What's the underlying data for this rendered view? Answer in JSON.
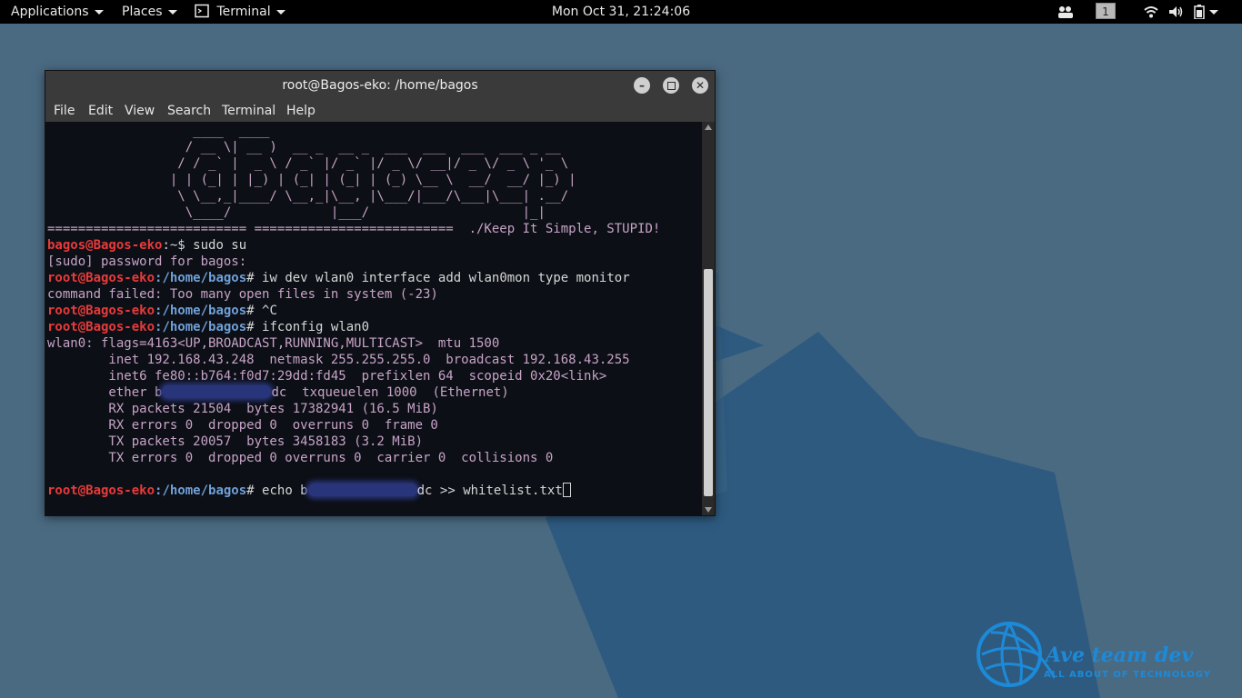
{
  "topbar": {
    "applications": "Applications",
    "places": "Places",
    "terminal": "Terminal",
    "clock": "Mon Oct 31, 21:24:06",
    "workspace": "1",
    "icons": [
      "people-icon",
      "wifi-icon",
      "volume-icon",
      "battery-icon",
      "power-menu-icon"
    ]
  },
  "window": {
    "title": "root@Bagos-eko: /home/bagos",
    "menu": [
      "File",
      "Edit",
      "View",
      "Search",
      "Terminal",
      "Help"
    ]
  },
  "terminal": {
    "ascii_art": [
      "                   ____  ____",
      "                  / __ \\| __ )  __ _  __ _  ___  ___  ___  ___ _ __",
      "                 / / _` |  _ \\ / _` |/ _` |/ _ \\/ __|/ _ \\/ _ \\ '_ \\",
      "                | | (_| | |_) | (_| | (_| | (_) \\__ \\  __/  __/ |_) |",
      "                 \\ \\__,_|____/ \\__,_|\\__, |\\___/|___/\\___|\\___| .__/",
      "                  \\____/             |___/                    |_|"
    ],
    "separator": "========================== ==========================  ./Keep It Simple, STUPID!",
    "user_prompt_user": "bagos@Bagos-eko",
    "user_prompt_rest": ":~$",
    "cmd_sudo": " sudo su",
    "sudo_prompt": "[sudo] password for bagos:",
    "root_prompt_host": "root@Bagos-eko",
    "root_prompt_path": ":/home/bagos",
    "root_prompt_end": "#",
    "cmd_iw": " iw dev wlan0 interface add wlan0mon type monitor",
    "err_iw": "command failed: Too many open files in system (-23)",
    "cmd_ctrlc": " ^C",
    "cmd_ifconfig": " ifconfig wlan0",
    "if_lines": [
      "wlan0: flags=4163<UP,BROADCAST,RUNNING,MULTICAST>  mtu 1500",
      "        inet 192.168.43.248  netmask 255.255.255.0  broadcast 192.168.43.255",
      "        inet6 fe80::b764:f0d7:29dd:fd45  prefixlen 64  scopeid 0x20<link>"
    ],
    "ether_prefix": "        ether b",
    "ether_suffix": "dc  txqueuelen 1000  (Ethernet)",
    "stats_lines": [
      "        RX packets 21504  bytes 17382941 (16.5 MiB)",
      "        RX errors 0  dropped 0  overruns 0  frame 0",
      "        TX packets 20057  bytes 3458183 (3.2 MiB)",
      "        TX errors 0  dropped 0 overruns 0  carrier 0  collisions 0"
    ],
    "echo_prefix": " echo b",
    "echo_suffix": "dc >> whitelist.txt"
  },
  "watermark": {
    "name": "Ave team dev",
    "tagline": "ALL ABOUT OF TECHNOLOGY"
  },
  "colors": {
    "desktop": "#4a6a82",
    "prompt_red": "#e83a3a",
    "path_blue": "#6fa0d8",
    "output_purple": "#c7a3c7",
    "watermark_blue": "#1d8ad8"
  }
}
